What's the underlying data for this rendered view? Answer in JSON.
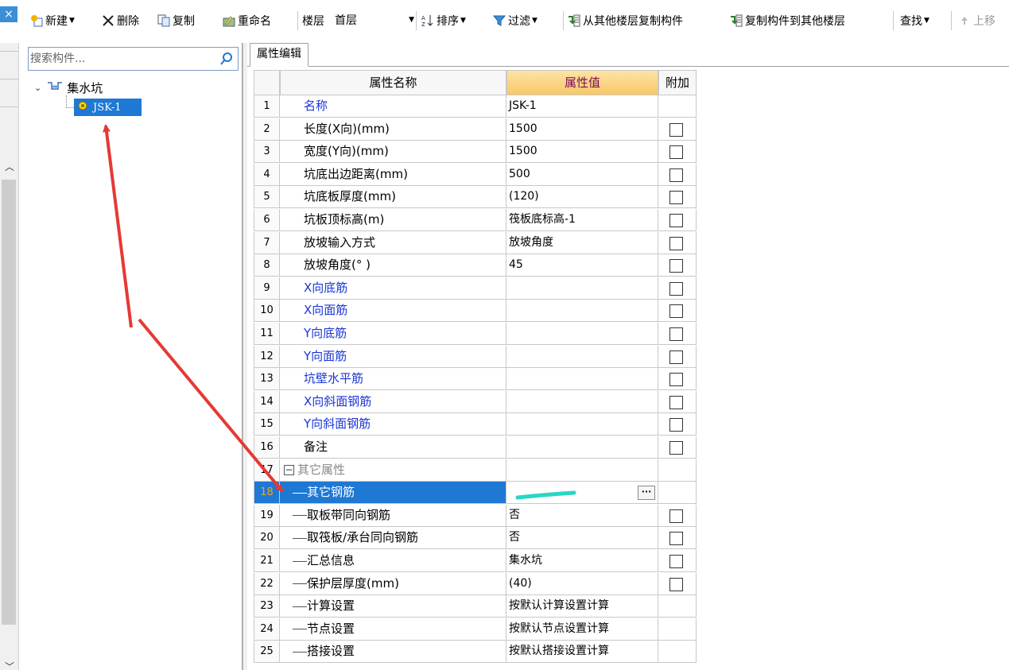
{
  "toolbar": {
    "close": "×",
    "new": "新建",
    "delete": "删除",
    "copy": "复制",
    "rename": "重命名",
    "floor_label": "楼层",
    "floor_value": "首层",
    "sort": "排序",
    "filter": "过滤",
    "copy_from_floor": "从其他楼层复制构件",
    "copy_to_floor": "复制构件到其他楼层",
    "find": "查找",
    "move_up": "上移"
  },
  "tree": {
    "search_placeholder": "搜索构件...",
    "root_label": "集水坑",
    "child_label": "JSK-1"
  },
  "tab": {
    "label": "属性编辑"
  },
  "grid": {
    "headers": {
      "name": "属性名称",
      "value": "属性值",
      "extra": "附加"
    },
    "rows": [
      {
        "num": "1",
        "name": "名称",
        "value": "JSK-1"
      },
      {
        "num": "2",
        "name": "长度(X向)(mm)",
        "value": "1500"
      },
      {
        "num": "3",
        "name": "宽度(Y向)(mm)",
        "value": "1500"
      },
      {
        "num": "4",
        "name": "坑底出边距离(mm)",
        "value": "500"
      },
      {
        "num": "5",
        "name": "坑底板厚度(mm)",
        "value": "(120)"
      },
      {
        "num": "6",
        "name": "坑板顶标高(m)",
        "value": "筏板底标高-1"
      },
      {
        "num": "7",
        "name": "放坡输入方式",
        "value": "放坡角度"
      },
      {
        "num": "8",
        "name": "放坡角度(° )",
        "value": "45"
      },
      {
        "num": "9",
        "name": "X向底筋",
        "value": ""
      },
      {
        "num": "10",
        "name": "X向面筋",
        "value": ""
      },
      {
        "num": "11",
        "name": "Y向底筋",
        "value": ""
      },
      {
        "num": "12",
        "name": "Y向面筋",
        "value": ""
      },
      {
        "num": "13",
        "name": "坑壁水平筋",
        "value": ""
      },
      {
        "num": "14",
        "name": "X向斜面钢筋",
        "value": ""
      },
      {
        "num": "15",
        "name": "Y向斜面钢筋",
        "value": ""
      },
      {
        "num": "16",
        "name": "备注",
        "value": ""
      },
      {
        "num": "17",
        "name": "其它属性",
        "value": ""
      },
      {
        "num": "18",
        "name": "其它钢筋",
        "value": ""
      },
      {
        "num": "19",
        "name": "取板带同向钢筋",
        "value": "否"
      },
      {
        "num": "20",
        "name": "取筏板/承台同向钢筋",
        "value": "否"
      },
      {
        "num": "21",
        "name": "汇总信息",
        "value": "集水坑"
      },
      {
        "num": "22",
        "name": "保护层厚度(mm)",
        "value": "(40)"
      },
      {
        "num": "23",
        "name": "计算设置",
        "value": "按默认计算设置计算"
      },
      {
        "num": "24",
        "name": "节点设置",
        "value": "按默认节点设置计算"
      },
      {
        "num": "25",
        "name": "搭接设置",
        "value": "按默认搭接设置计算"
      }
    ],
    "ellipsis": "···",
    "collapse_glyph": "−"
  },
  "colors": {
    "selection": "#1e78d4",
    "annotation_arrow": "#e53935",
    "highlight_stroke": "#2ad6c4",
    "header_value_bg": "#f8c86a"
  }
}
